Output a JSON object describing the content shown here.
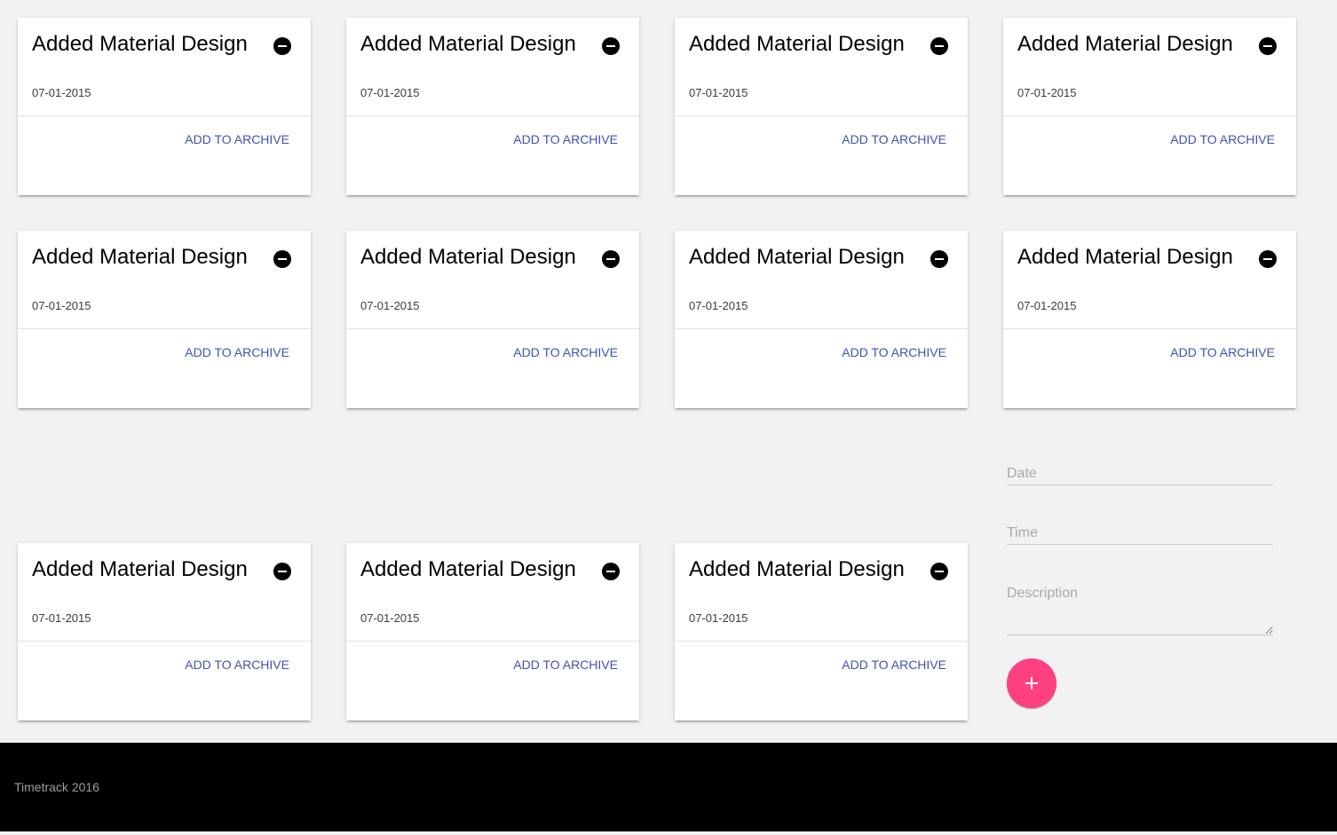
{
  "cards": [
    {
      "title": "Added Material Design",
      "date": "07-01-2015",
      "action": "ADD TO ARCHIVE"
    },
    {
      "title": "Added Material Design",
      "date": "07-01-2015",
      "action": "ADD TO ARCHIVE"
    },
    {
      "title": "Added Material Design",
      "date": "07-01-2015",
      "action": "ADD TO ARCHIVE"
    },
    {
      "title": "Added Material Design",
      "date": "07-01-2015",
      "action": "ADD TO ARCHIVE"
    },
    {
      "title": "Added Material Design",
      "date": "07-01-2015",
      "action": "ADD TO ARCHIVE"
    },
    {
      "title": "Added Material Design",
      "date": "07-01-2015",
      "action": "ADD TO ARCHIVE"
    },
    {
      "title": "Added Material Design",
      "date": "07-01-2015",
      "action": "ADD TO ARCHIVE"
    },
    {
      "title": "Added Material Design",
      "date": "07-01-2015",
      "action": "ADD TO ARCHIVE"
    },
    {
      "title": "Added Material Design",
      "date": "07-01-2015",
      "action": "ADD TO ARCHIVE"
    },
    {
      "title": "Added Material Design",
      "date": "07-01-2015",
      "action": "ADD TO ARCHIVE"
    },
    {
      "title": "Added Material Design",
      "date": "07-01-2015",
      "action": "ADD TO ARCHIVE"
    }
  ],
  "icons": {
    "remove": "remove-circle-icon",
    "add": "plus-icon"
  },
  "form": {
    "date_placeholder": "Date",
    "date_value": "",
    "time_placeholder": "Time",
    "time_value": "",
    "description_placeholder": "Description",
    "description_value": ""
  },
  "footer": {
    "text": "Timetrack 2016"
  },
  "colors": {
    "background": "#f2f2f2",
    "card": "#ffffff",
    "accent_action": "#3f51b5",
    "fab": "#ff4081",
    "footer": "#000000",
    "footer_text": "#9e9e9e"
  }
}
